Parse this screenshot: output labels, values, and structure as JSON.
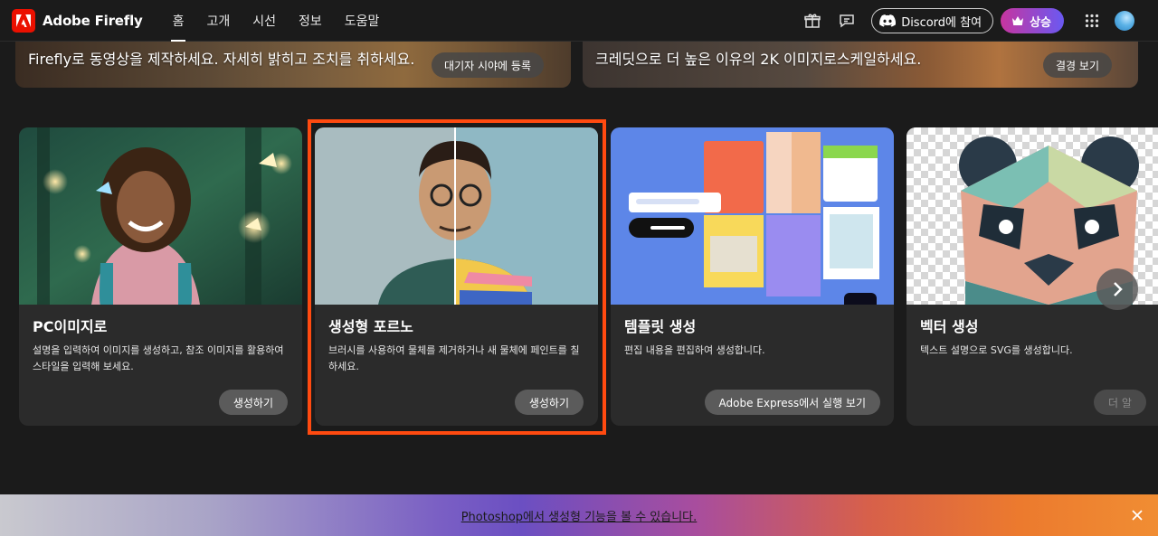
{
  "app": {
    "name": "Adobe Firefly"
  },
  "nav": {
    "items": [
      {
        "label": "홈",
        "active": true
      },
      {
        "label": "고개",
        "active": false
      },
      {
        "label": "시선",
        "active": false
      },
      {
        "label": "정보",
        "active": false
      },
      {
        "label": "도움말",
        "active": false
      }
    ]
  },
  "toolbar": {
    "gift_icon": "gift-icon",
    "chat_icon": "chat-bubble-icon",
    "discord_label": "Discord에 참여",
    "upgrade_label": "상승",
    "apps_icon": "apps-grid-icon"
  },
  "banners": [
    {
      "text": "Firefly로 동영상을 제작하세요. 자세히 밝히고 조치를 취하세요.",
      "button": "대기자 시야에 등록"
    },
    {
      "text": "크레딧으로 더 높은 이유의 2K 이미지로스케일하세요.",
      "button": "결경 보기"
    }
  ],
  "cards": [
    {
      "title": "PC이미지로",
      "desc": "설명을 입력하여 이미지를 생성하고, 참조 이미지를 활용하여 스타일을 입력해 보세요.",
      "button": "생성하기"
    },
    {
      "title": "생성형 포르노",
      "desc": "브러시를 사용하여 물체를 제거하거나 새 물체에 페인트를 칠하세요.",
      "button": "생성하기"
    },
    {
      "title": "템플릿 생성",
      "desc": "편집 내용을 편집하여 생성합니다.",
      "button": "Adobe Express에서 실행 보기"
    },
    {
      "title": "벡터 생성",
      "desc": "텍스트 설명으로 SVG를 생성합니다.",
      "button": "더 알"
    }
  ],
  "promo": {
    "text": "Photoshop에서 생성형 기능을 볼 수 있습니다."
  },
  "colors": {
    "accent_upgrade_start": "#c7359f",
    "accent_upgrade_end": "#6a59f2",
    "highlight_border": "#ff4a10",
    "logo_red": "#eb1000"
  }
}
